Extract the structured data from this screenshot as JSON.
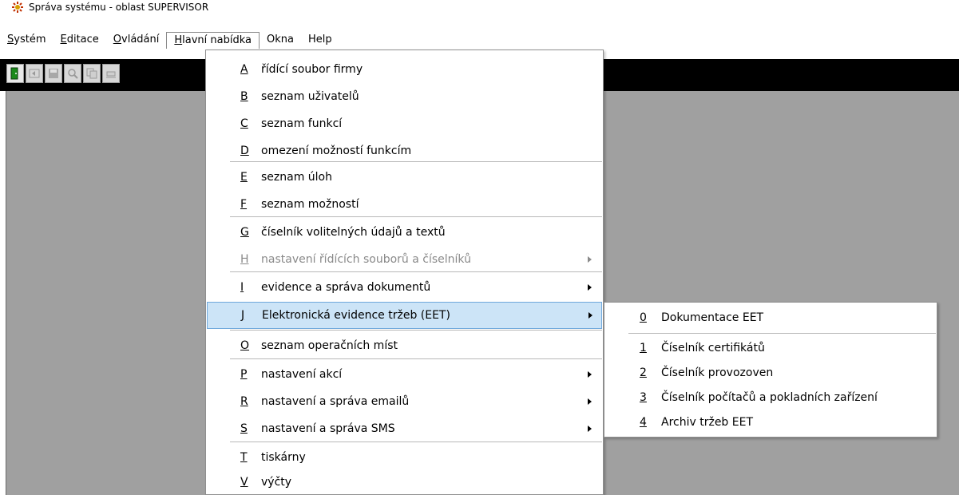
{
  "window": {
    "title": "Správa systému - oblast SUPERVISOR",
    "icon": "app-logo-icon"
  },
  "menubar": {
    "items": [
      {
        "mnemonic": "S",
        "rest": "ystém"
      },
      {
        "mnemonic": "E",
        "rest": "ditace"
      },
      {
        "mnemonic": "O",
        "rest": "vládání"
      },
      {
        "mnemonic": "H",
        "rest": "lavní nabídka"
      },
      {
        "mnemonic": "",
        "rest": "Okna"
      },
      {
        "mnemonic": "",
        "rest": "Help"
      }
    ],
    "active_index": 3
  },
  "toolbar": {
    "buttons": [
      "exit-door-icon",
      "back-icon",
      "save-icon",
      "search-icon",
      "copy-icon",
      "eraser-icon"
    ]
  },
  "main_menu": {
    "items": [
      {
        "key": "A",
        "label": "řídící soubor firmy"
      },
      {
        "key": "B",
        "label": "seznam uživatelů"
      },
      {
        "key": "C",
        "label": "seznam funkcí"
      },
      {
        "key": "D",
        "label": "omezení možností funkcím"
      },
      {
        "key": "E",
        "label": "seznam úloh"
      },
      {
        "key": "F",
        "label": "seznam možností"
      },
      {
        "key": "G",
        "label": "číselník volitelných údajů a textů"
      },
      {
        "key": "H",
        "label": "nastavení řídících souborů a číselníků",
        "submenu": true,
        "disabled": true
      },
      {
        "key": "I",
        "label": "evidence a správa dokumentů",
        "submenu": true
      },
      {
        "key": "J",
        "label": "Elektronická evidence tržeb (EET)",
        "submenu": true,
        "highlighted": true
      },
      {
        "key": "O",
        "label": "seznam operačních míst"
      },
      {
        "key": "P",
        "label": "nastavení akcí",
        "submenu": true
      },
      {
        "key": "R",
        "label": "nastavení a správa emailů",
        "submenu": true
      },
      {
        "key": "S",
        "label": "nastavení a správa SMS",
        "submenu": true
      },
      {
        "key": "T",
        "label": "tiskárny"
      },
      {
        "key": "V",
        "label": "výčty"
      }
    ]
  },
  "submenu": {
    "items": [
      {
        "key": "0",
        "label": "Dokumentace EET"
      },
      {
        "key": "1",
        "label": "Číselník certifikátů"
      },
      {
        "key": "2",
        "label": "Číselník provozoven"
      },
      {
        "key": "3",
        "label": "Číselník počítačů a pokladních zařízení"
      },
      {
        "key": "4",
        "label": "Archiv tržeb EET"
      }
    ]
  },
  "colors": {
    "highlight_bg": "#cce4f7",
    "highlight_border": "#6fa8dc",
    "workarea": "#a0a0a0",
    "toolbar": "#000000"
  }
}
